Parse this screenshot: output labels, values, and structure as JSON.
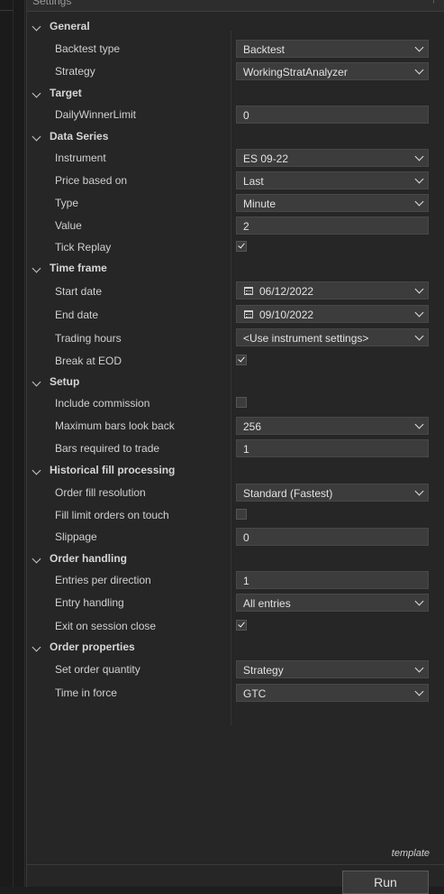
{
  "panel": {
    "title": "Settings",
    "pin_glyph": "↑"
  },
  "template_label": "template",
  "run_label": "Run",
  "categories": {
    "general": "General",
    "target": "Target",
    "data_series": "Data Series",
    "time_frame": "Time frame",
    "setup": "Setup",
    "historical": "Historical fill processing",
    "order_handling": "Order handling",
    "order_properties": "Order properties"
  },
  "props": {
    "backtest_type": {
      "label": "Backtest type",
      "value": "Backtest"
    },
    "strategy": {
      "label": "Strategy",
      "value": "WorkingStratAnalyzer"
    },
    "daily_winner_limit": {
      "label": "DailyWinnerLimit",
      "value": "0"
    },
    "instrument": {
      "label": "Instrument",
      "value": "ES 09-22"
    },
    "price_based_on": {
      "label": "Price based on",
      "value": "Last"
    },
    "type": {
      "label": "Type",
      "value": "Minute"
    },
    "value": {
      "label": "Value",
      "value": "2"
    },
    "tick_replay": {
      "label": "Tick Replay",
      "checked": true
    },
    "start_date": {
      "label": "Start date",
      "value": "06/12/2022"
    },
    "end_date": {
      "label": "End date",
      "value": "09/10/2022"
    },
    "trading_hours": {
      "label": "Trading hours",
      "value": "<Use instrument settings>"
    },
    "break_at_eod": {
      "label": "Break at EOD",
      "checked": true
    },
    "include_commission": {
      "label": "Include commission",
      "checked": false
    },
    "max_bars_look_back": {
      "label": "Maximum bars look back",
      "value": "256"
    },
    "bars_required": {
      "label": "Bars required to trade",
      "value": "1"
    },
    "order_fill_resolution": {
      "label": "Order fill resolution",
      "value": "Standard (Fastest)"
    },
    "fill_limit_on_touch": {
      "label": "Fill limit orders on touch",
      "checked": false
    },
    "slippage": {
      "label": "Slippage",
      "value": "0"
    },
    "entries_per_direction": {
      "label": "Entries per direction",
      "value": "1"
    },
    "entry_handling": {
      "label": "Entry handling",
      "value": "All entries"
    },
    "exit_on_session_close": {
      "label": "Exit on session close",
      "checked": true
    },
    "set_order_quantity": {
      "label": "Set order quantity",
      "value": "Strategy"
    },
    "time_in_force": {
      "label": "Time in force",
      "value": "GTC"
    }
  }
}
